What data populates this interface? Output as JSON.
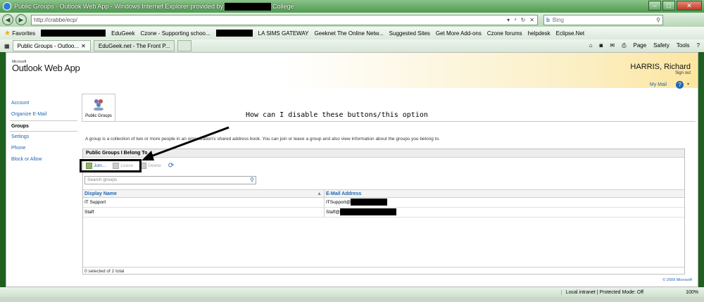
{
  "window": {
    "title": "Public Groups - Outlook Web App - Windows Internet Explorer provided by",
    "title_suffix": "College"
  },
  "addressbar": {
    "url": "http://crabbe/ecp/",
    "search_placeholder": "Bing"
  },
  "favorites": {
    "label": "Favorites",
    "items": [
      "EduGeek",
      "Czone - Supporting schoo...",
      "LA SIMS GATEWAY",
      "Geeknet  The Online Netw...",
      "Suggested Sites",
      "Get More Add-ons",
      "Czone forums",
      "helpdesk",
      "Eclipse.Net"
    ]
  },
  "tabs": [
    {
      "label": "Public Groups - Outloo..."
    },
    {
      "label": "EduGeek.net - The Front P..."
    }
  ],
  "ie_tools": {
    "page": "Page",
    "safety": "Safety",
    "tools": "Tools"
  },
  "owa": {
    "brand_small": "Microsoft",
    "brand": "Outlook Web App",
    "user": "HARRIS, Richard",
    "sign_out": "Sign out",
    "my_mail": "My Mail",
    "nav": [
      "Account",
      "Organize E-Mail",
      "Groups",
      "Settings",
      "Phone",
      "Block or Allow"
    ],
    "page_tab": "Public Groups",
    "annotation": "How can I disable these buttons/this option",
    "description": "A group is a collection of two or more people in an organization's shared address book. You can join or leave a group and also view information about the groups you belong to.",
    "panel_title": "Public Groups I Belong To",
    "buttons": {
      "join": "Join...",
      "leave": "Leave",
      "delete": "Delete"
    },
    "search_placeholder": "Search groups",
    "columns": [
      "Display Name",
      "E-Mail Address"
    ],
    "rows": [
      {
        "name": "IT Support",
        "email": "ITSupport@"
      },
      {
        "name": "Staff",
        "email": "Staff@"
      }
    ],
    "footer": "0 selected of 2 total",
    "copyright": "© 2009 Microsoft"
  },
  "status": {
    "zone": "Local intranet | Protected Mode: Off",
    "zoom": "100%"
  }
}
